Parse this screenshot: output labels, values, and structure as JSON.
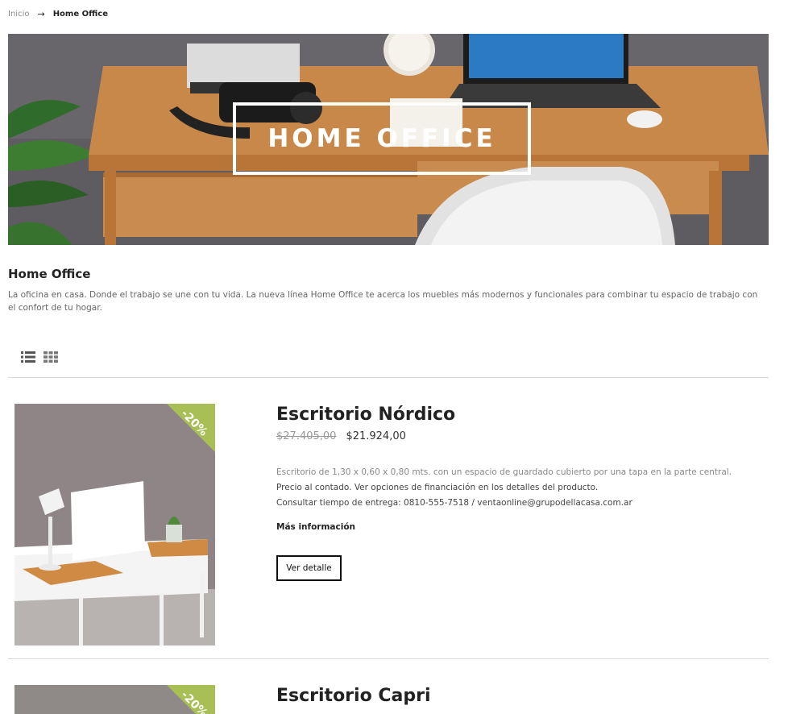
{
  "breadcrumb": {
    "home": "Inicio",
    "separator": "→",
    "current": "Home Office"
  },
  "banner": {
    "title": "HOME OFFICE"
  },
  "category": {
    "title": "Home Office",
    "description": "La oficina en casa. Donde el trabajo se une con tu vida. La nueva línea Home Office te acerca los muebles más modernos y funcionales para combinar tu espacio de trabajo con el confort de tu hogar."
  },
  "view_toggles": {
    "list_icon": "list-view-icon",
    "grid_icon": "grid-view-icon"
  },
  "products": [
    {
      "badge": "-20%",
      "title": "Escritorio Nórdico",
      "old_price": "$27.405,00",
      "price": "$21.924,00",
      "desc_1": "Escritorio de 1,30 x 0,60 x 0,80 mts. con un espacio de guardado cubierto por una tapa en la parte central.",
      "desc_2": "Precio al contado. Ver opciones de financiación en los detalles del producto.",
      "desc_3": "Consultar tiempo de entrega: 0810-555-7518 / ventaonline@grupodellacasa.com.ar",
      "more_info": "Más información",
      "detail_button": "Ver detalle"
    },
    {
      "badge": "-20%",
      "title": "Escritorio Capri"
    }
  ],
  "colors": {
    "badge": "#a7bf55",
    "wall": "#5e5b60",
    "wood": "#c8884a"
  }
}
